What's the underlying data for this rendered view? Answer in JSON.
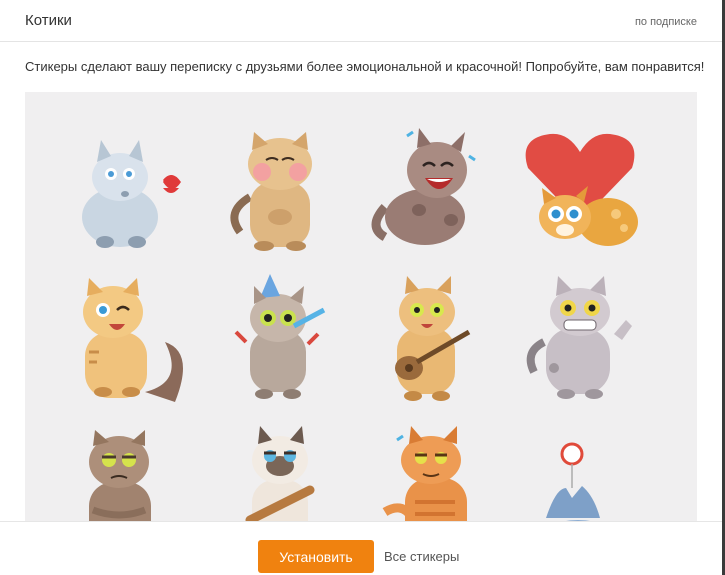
{
  "header": {
    "title": "Котики",
    "subscription": "по подписке"
  },
  "description": "Стикеры сделают вашу переписку с друзьями более эмоциональной и красочной! Попробуйте, вам понравится!",
  "stickers": [
    "cat-sticker-kiss",
    "cat-sticker-blush",
    "cat-sticker-laugh",
    "cat-sticker-heart",
    "cat-sticker-wink",
    "cat-sticker-party",
    "cat-sticker-guitar",
    "cat-sticker-grin",
    "cat-sticker-grumpy",
    "cat-sticker-siamese-bat",
    "cat-sticker-orange-smug",
    "cat-sticker-yoyo"
  ],
  "footer": {
    "install_label": "Установить",
    "all_stickers_label": "Все стикеры"
  },
  "colors": {
    "accent": "#f0820f",
    "stage_bg": "#f0eff0"
  }
}
